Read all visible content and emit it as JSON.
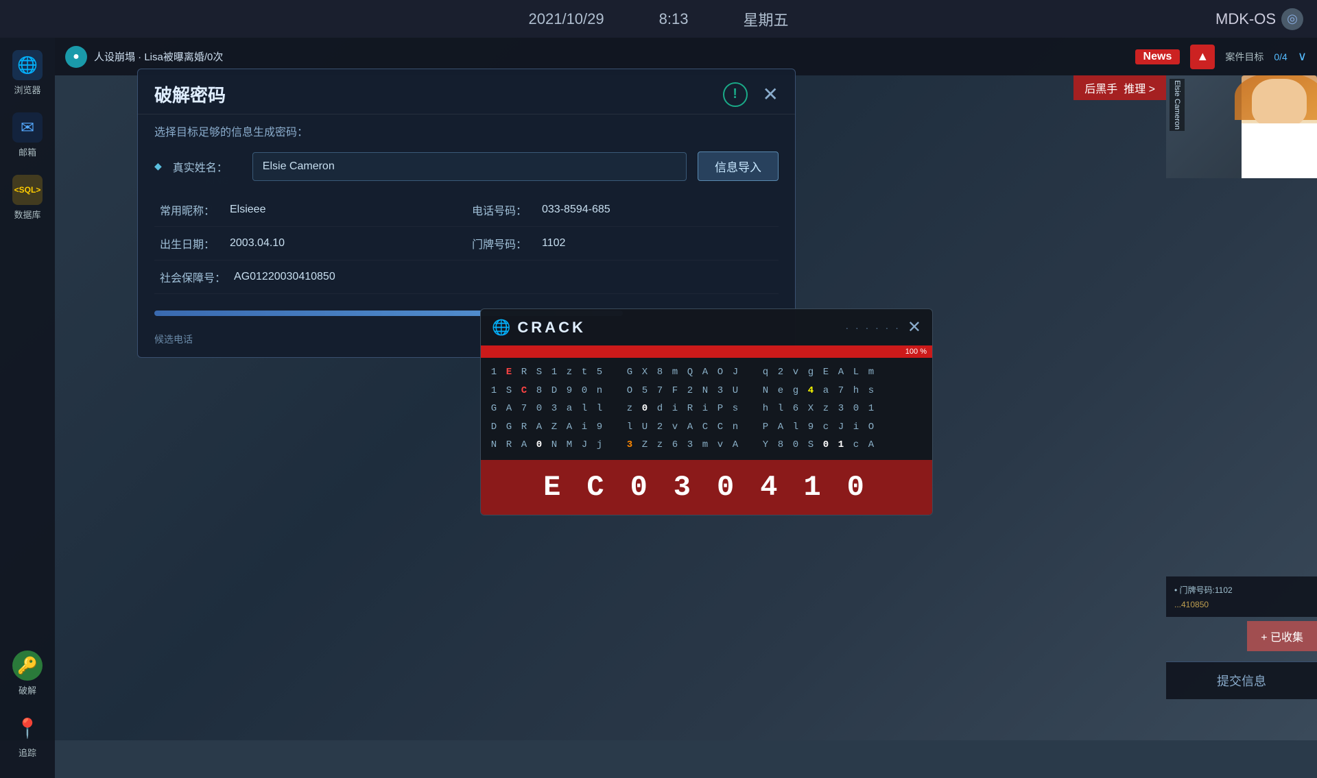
{
  "topbar": {
    "date": "2021/10/29",
    "time": "8:13",
    "weekday": "星期五",
    "brand": "MDK-OS"
  },
  "header": {
    "logo_symbol": "●",
    "title": "人设崩塌 · Lisa被曝离婚/0次",
    "news_label": "News",
    "alert_symbol": "▲",
    "target_label": "案件目标",
    "target_count": "0/4",
    "expand_symbol": "∨"
  },
  "sidebar": {
    "items": [
      {
        "label": "浏览器",
        "icon": "🌐"
      },
      {
        "label": "邮箱",
        "icon": "✉"
      },
      {
        "label": "数据库",
        "icon": "SQL"
      },
      {
        "label": "破解",
        "icon": "🔑"
      },
      {
        "label": "追踪",
        "icon": "📍"
      }
    ]
  },
  "crack_dialog": {
    "title": "破解密码",
    "info_icon": "!",
    "close_symbol": "✕",
    "subtitle": "选择目标足够的信息生成密码：",
    "real_name_label": "真实姓名：",
    "real_name_value": "Elsie Cameron",
    "import_btn_label": "信息导入",
    "nickname_label": "常用昵称：",
    "nickname_value": "Elsieee",
    "phone_label": "电话号码：",
    "phone_value": "033-8594-685",
    "birthday_label": "出生日期：",
    "birthday_value": "2003.04.10",
    "door_label": "门牌号码：",
    "door_value": "1102",
    "ssn_label": "社会保障号：",
    "ssn_value": "AG01220030410850",
    "progress_pct": 75,
    "footer_text1": "候选电话",
    "footer_text2": ""
  },
  "crack_popup": {
    "globe_symbol": "🌐",
    "title": "CRACK",
    "dots": "· · · · · ·",
    "close_symbol": "✕",
    "progress_pct": 100,
    "progress_label": "100 %",
    "matrix_rows": [
      "1 E R S 1 z t 5   G X 8 m Q A O J   q 2 v g E A L m",
      "1 S C 8 D 9 0 n   O 5 7 F 2 N 3 U   N e g 4 a 7 h s",
      "G A 7 0 3 a l l   z 0 d i R i P s   h l 6 X z 3 0 1",
      "D G R A Z A i 9   l U 2 v A C C n   P A l 9 c J i O",
      "N R A 0 N M J j   3 Z z 6 3 m v A   Y 8 0 S 0 1 c A"
    ],
    "result_chars": [
      "E",
      "C",
      "0",
      "3",
      "0",
      "4",
      "1",
      "0"
    ]
  },
  "right_panel": {
    "suspect_name": "Elsie Cameron",
    "collected_items": [
      "门牌号码:1102"
    ],
    "collected_btn_label": "+ 已收集",
    "submit_btn_label": "提交信息"
  },
  "reason_btn": {
    "label": "推理",
    "arrow": ">"
  },
  "culprit_label": "后黑手"
}
